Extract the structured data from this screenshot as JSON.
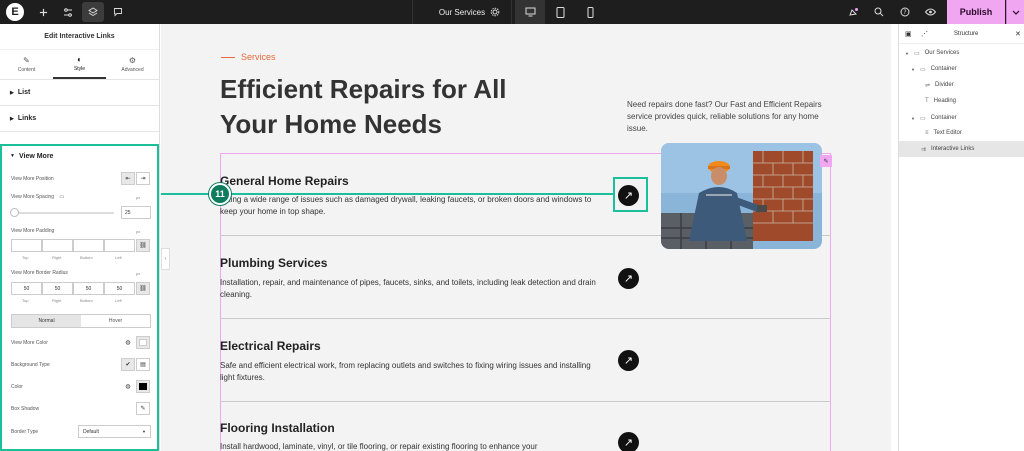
{
  "topbar": {
    "document_name": "Our Services",
    "publish_label": "Publish",
    "icons": [
      "elementor-logo-icon",
      "add-icon",
      "sliders-icon",
      "layers-icon",
      "comment-icon",
      "settings-icon",
      "desktop-icon",
      "tablet-icon",
      "mobile-icon",
      "notifications-icon",
      "search-icon",
      "help-icon",
      "preview-icon",
      "chevron-down-icon"
    ],
    "logo_letter": "E"
  },
  "left_panel": {
    "title": "Edit Interactive Links",
    "tabs": [
      {
        "label": "Content",
        "icon": "pencil-icon"
      },
      {
        "label": "Style",
        "icon": "contrast-icon"
      },
      {
        "label": "Advanced",
        "icon": "gear-icon"
      }
    ],
    "sections": [
      "List",
      "Links",
      "View More"
    ],
    "view_more": {
      "position_label": "View More Position",
      "spacing_label": "View More Spacing",
      "spacing_unit": "px",
      "spacing_value": "25",
      "padding_label": "View More Padding",
      "padding_unit": "px",
      "padding_values": [
        "",
        "",
        "",
        ""
      ],
      "sides": [
        "Top",
        "Right",
        "Bottom",
        "Left"
      ],
      "border_radius_label": "View More Border Radius",
      "border_radius_unit": "px",
      "border_radius_values": [
        "50",
        "50",
        "50",
        "50"
      ],
      "state_tabs": [
        "Normal",
        "Hover"
      ],
      "color_label": "View More Color",
      "bg_type_label": "Background Type",
      "color2_label": "Color",
      "box_shadow_label": "Box Shadow",
      "border_type_label": "Border Type",
      "border_type_value": "Default"
    }
  },
  "page": {
    "eyebrow": "Services",
    "heading": "Efficient Repairs for All Your Home Needs",
    "intro": "Need repairs done fast? Our Fast and Efficient Repairs service provides quick, reliable solutions for any home issue.",
    "items": [
      {
        "title": "General Home Repairs",
        "desc": "Fixing a wide range of issues such as damaged drywall, leaking faucets, or broken doors and windows to keep your home in top shape."
      },
      {
        "title": "Plumbing Services",
        "desc": "Installation, repair, and maintenance of pipes, faucets, sinks, and toilets, including leak detection and drain cleaning."
      },
      {
        "title": "Electrical Repairs",
        "desc": "Safe and efficient electrical work, from replacing outlets and switches to fixing wiring issues and installing light fixtures."
      },
      {
        "title": "Flooring Installation",
        "desc": "Install hardwood, laminate, vinyl, or tile flooring, or repair existing flooring to enhance your"
      }
    ],
    "callout_number": "11"
  },
  "structure": {
    "title": "Structure",
    "nodes": [
      {
        "label": "Our Services",
        "level": 0
      },
      {
        "label": "Container",
        "level": 1
      },
      {
        "label": "Divider",
        "level": 2
      },
      {
        "label": "Heading",
        "level": 2
      },
      {
        "label": "Container",
        "level": 1
      },
      {
        "label": "Text Editor",
        "level": 2
      },
      {
        "label": "Interactive Links",
        "level": 1
      }
    ]
  },
  "colors": {
    "accent": "#1bbf9a",
    "publish": "#f0a6f0",
    "eyebrow": "#e86a3c",
    "badge": "#0f7b5f"
  }
}
